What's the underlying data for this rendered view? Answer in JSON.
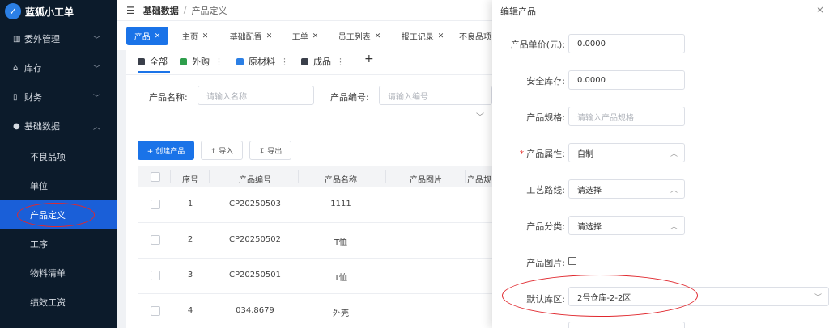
{
  "app": {
    "name": "蓝狐小工单"
  },
  "sidebar": {
    "groups": [
      {
        "label": "委外管理",
        "icon": "building-icon"
      },
      {
        "label": "库存",
        "icon": "box-icon"
      },
      {
        "label": "财务",
        "icon": "book-icon"
      },
      {
        "label": "基础数据",
        "icon": "settings-icon"
      }
    ],
    "sub_items": [
      "不良品项",
      "单位",
      "产品定义",
      "工序",
      "物料清单",
      "绩效工资"
    ],
    "active_item": "产品定义"
  },
  "breadcrumb": {
    "root": "基础数据",
    "sep": "/",
    "current": "产品定义"
  },
  "tabs": [
    {
      "label": "产品",
      "active": true
    },
    {
      "label": "主页"
    },
    {
      "label": "基础配置"
    },
    {
      "label": "工单"
    },
    {
      "label": "员工列表"
    },
    {
      "label": "报工记录"
    },
    {
      "label": "不良品项"
    }
  ],
  "categories": [
    {
      "label": "全部",
      "color": "#3a3f4a"
    },
    {
      "label": "外购",
      "color": "#2e9e4c"
    },
    {
      "label": "原材料",
      "color": "#2b7fe5"
    },
    {
      "label": "成品",
      "color": "#3a3f4a"
    }
  ],
  "add_category": "+",
  "filters": {
    "name_label": "产品名称:",
    "name_placeholder": "请输入名称",
    "code_label": "产品编号:",
    "code_placeholder": "请输入编号"
  },
  "actions": {
    "create": "+ 创建产品",
    "import": "↥ 导入",
    "export": "↧ 导出"
  },
  "table": {
    "headers": [
      "序号",
      "产品编号",
      "产品名称",
      "产品图片",
      "产品规"
    ],
    "rows": [
      {
        "idx": "1",
        "code": "CP20250503",
        "name": "1111"
      },
      {
        "idx": "2",
        "code": "CP20250502",
        "name": "T恤"
      },
      {
        "idx": "3",
        "code": "CP20250501",
        "name": "T恤"
      },
      {
        "idx": "4",
        "code": "034.8679",
        "name": "外壳"
      }
    ]
  },
  "drawer": {
    "title": "编辑产品",
    "close": "×",
    "fields": [
      {
        "label": "产品单价(元):",
        "value": "0.0000"
      },
      {
        "label": "安全库存:",
        "value": "0.0000"
      },
      {
        "label": "产品规格:",
        "placeholder": "请输入产品规格"
      },
      {
        "label": "产品属性:",
        "value": "自制",
        "required": "*"
      },
      {
        "label": "工艺路线:",
        "value": "请选择"
      },
      {
        "label": "产品分类:",
        "value": "请选择"
      },
      {
        "label": "产品图片:"
      },
      {
        "label": "默认库区:",
        "value": "2号仓库-2-2区"
      }
    ]
  },
  "annotation_color": "#e0282e"
}
